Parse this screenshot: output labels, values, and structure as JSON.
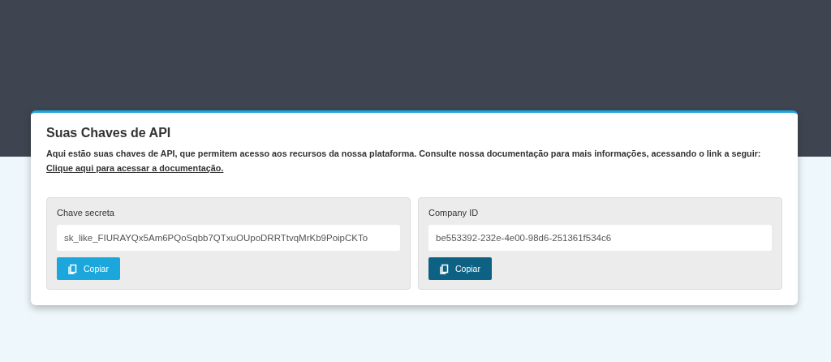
{
  "title": "Suas Chaves de API",
  "description": "Aqui estão suas chaves de API, que permitem acesso aos recursos da nossa plataforma. Consulte nossa documentação para mais informações, acessando o link a seguir:",
  "doc_link": "Clique aqui para acessar a documentação.",
  "keys": [
    {
      "label": "Chave secreta",
      "value": "sk_like_FIURAYQx5Am6PQoSqbb7QTxuOUpoDRRTtvqMrKb9PoipCKTo",
      "button": "Copiar",
      "color": "#1ba6dc"
    },
    {
      "label": "Company ID",
      "value": "be553392-232e-4e00-98d6-251361f534c6",
      "button": "Copiar",
      "color": "#0d6284"
    }
  ]
}
